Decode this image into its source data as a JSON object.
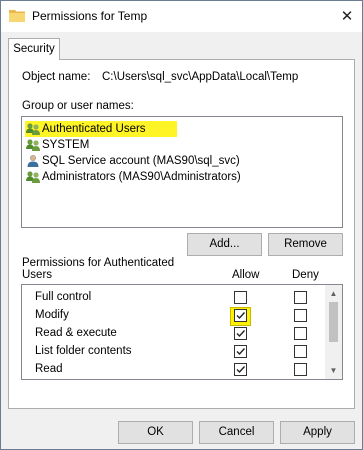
{
  "window": {
    "title": "Permissions for Temp",
    "close_glyph": "✕"
  },
  "tabs": [
    {
      "label": "Security"
    }
  ],
  "object": {
    "label": "Object name:",
    "value": "C:\\Users\\sql_svc\\AppData\\Local\\Temp"
  },
  "groups": {
    "label": "Group or user names:",
    "items": [
      {
        "label": "Authenticated Users",
        "icon": "users-group-icon",
        "selected": true
      },
      {
        "label": "SYSTEM",
        "icon": "users-group-icon",
        "selected": false
      },
      {
        "label": "SQL Service account (MAS90\\sql_svc)",
        "icon": "user-icon",
        "selected": false
      },
      {
        "label": "Administrators (MAS90\\Administrators)",
        "icon": "users-group-icon",
        "selected": false
      }
    ],
    "add_label": "Add...",
    "remove_label": "Remove"
  },
  "permissions": {
    "label_line1": "Permissions for Authenticated",
    "label_line2": "Users",
    "allow_header": "Allow",
    "deny_header": "Deny",
    "rows": [
      {
        "name": "Full control",
        "allow": false,
        "deny": false
      },
      {
        "name": "Modify",
        "allow": true,
        "deny": false,
        "highlighted": true
      },
      {
        "name": "Read & execute",
        "allow": true,
        "deny": false
      },
      {
        "name": "List folder contents",
        "allow": true,
        "deny": false
      },
      {
        "name": "Read",
        "allow": true,
        "deny": false
      },
      {
        "name": "",
        "allow": true,
        "deny": false
      }
    ]
  },
  "footer": {
    "ok_label": "OK",
    "cancel_label": "Cancel",
    "apply_label": "Apply"
  },
  "colors": {
    "highlight": "#fff200",
    "window_bg": "#f0f0f0",
    "border": "#adadad"
  }
}
